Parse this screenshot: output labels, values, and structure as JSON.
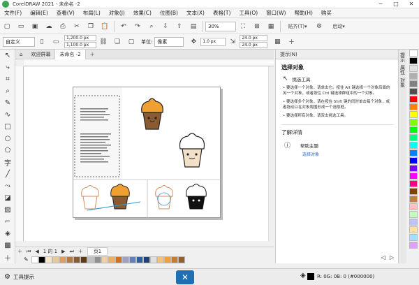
{
  "window": {
    "title": "CorelDRAW 2021 - 未命名 -2",
    "controls": [
      "─",
      "□",
      "✕"
    ]
  },
  "menu": [
    "文件(F)",
    "编辑(E)",
    "查看(V)",
    "布局(L)",
    "对象(J)",
    "效果(C)",
    "位图(B)",
    "文本(X)",
    "表格(T)",
    "工具(O)",
    "窗口(W)",
    "帮助(H)",
    "购买"
  ],
  "toolbar": {
    "zoom": "30%",
    "snap_label": "贴齐(T)",
    "launch_label": "启动"
  },
  "propertybar": {
    "page_preset": "自定义",
    "width": "1,200.0 px",
    "height": "1,100.0 px",
    "units_label": "单位:",
    "units_value": "像素",
    "nudge": "1.0 px",
    "dup_x": "24.0 px",
    "dup_y": "24.0 px"
  },
  "tabs": {
    "welcome": "欢迎屏幕",
    "doc": "未命名 -2"
  },
  "pagenav": {
    "counter": "1 的 1",
    "page_tab": "页1"
  },
  "hints": {
    "panel_title": "提示(N)",
    "title": "选择对象",
    "tool": "挑选工具",
    "bullets": [
      "要选择一个对象，请单击它。按住 Alt 键选择一个对象后面的另一个对象，或者按住 Ctrl 键选择群组中的一个对象。",
      "要选择多个对象，请在按住 Shift 键的同时单击每个对象，或者拖动以在对象周围形成一个选取框。",
      "要选择所有对象，请双击挑选工具。"
    ],
    "learn_more": "了解详情",
    "help_topic": "帮助主题",
    "help_link": "选择对象"
  },
  "dockers": [
    "提示",
    "属性",
    "对象"
  ],
  "status": {
    "tool_hints": "工具提示",
    "color_info": "R: 0G: 0B: 0 (#000000)"
  },
  "colors": {
    "accent": "#2a6ebb",
    "cupcake_orange": "#f0a030",
    "cupcake_brown": "#8a5a30",
    "cupcake_black": "#111111"
  },
  "palette_v": [
    "#ffffff",
    "#000000",
    "#e0e0e0",
    "#b0b0b0",
    "#808080",
    "#505050",
    "#ff0000",
    "#ff8000",
    "#ffff00",
    "#80ff00",
    "#00ff00",
    "#00ff80",
    "#00ffff",
    "#0080ff",
    "#0000ff",
    "#8000ff",
    "#ff00ff",
    "#ff0080",
    "#804000",
    "#c08040",
    "#ffc0c0",
    "#c0ffc0",
    "#c0c0ff",
    "#ffe0a0",
    "#a0e0ff",
    "#e0a0ff"
  ],
  "palette_h": [
    "#ffffff",
    "#000000",
    "#f5e6c8",
    "#e9c99a",
    "#d9a066",
    "#b87844",
    "#8c5a2c",
    "#5c3a1c",
    "#c0c0c0",
    "#909090",
    "#f0d0a0",
    "#e8b060",
    "#d07020",
    "#a0a0c0",
    "#6080c0",
    "#3060a0",
    "#204070",
    "#e0e0e0",
    "#f8c080",
    "#f0a040",
    "#c08030",
    "#906030"
  ]
}
